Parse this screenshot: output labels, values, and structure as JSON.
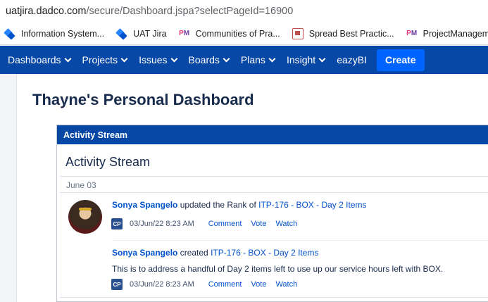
{
  "browser": {
    "url_host": "uatjira.dadco.com",
    "url_path": "/secure/Dashboard.jspa?selectPageId=16900"
  },
  "bookmarks": [
    {
      "icon": "jira-icon",
      "label": "Information System..."
    },
    {
      "icon": "jira-icon",
      "label": "UAT Jira"
    },
    {
      "icon": "pm-icon",
      "label": "Communities of Pra..."
    },
    {
      "icon": "presentation-icon",
      "label": "Spread Best Practic..."
    },
    {
      "icon": "pm-icon",
      "label": "ProjectManagemen..."
    }
  ],
  "nav": {
    "items": [
      {
        "label": "Dashboards",
        "has_dropdown": true
      },
      {
        "label": "Projects",
        "has_dropdown": true
      },
      {
        "label": "Issues",
        "has_dropdown": true
      },
      {
        "label": "Boards",
        "has_dropdown": true
      },
      {
        "label": "Plans",
        "has_dropdown": true
      },
      {
        "label": "Insight",
        "has_dropdown": true
      },
      {
        "label": "eazyBI",
        "has_dropdown": false
      }
    ],
    "create_label": "Create",
    "colors": {
      "nav_bg": "#0747a6",
      "create_bg": "#0065ff"
    }
  },
  "page": {
    "title": "Thayne's Personal Dashboard"
  },
  "gadget": {
    "header": "Activity Stream",
    "title": "Activity Stream",
    "date_group": "June 03",
    "entries": [
      {
        "user": "Sonya Spangelo",
        "action": " updated the Rank of ",
        "issue": "ITP-176 - BOX - Day 2 Items",
        "badge": "CP",
        "timestamp": "03/Jun/22 8:23 AM",
        "actions": [
          "Comment",
          "Vote",
          "Watch"
        ]
      },
      {
        "user": "Sonya Spangelo",
        "action": " created ",
        "issue": "ITP-176 - BOX - Day 2 Items",
        "description": "This is to address a handful of Day 2 items left to use up our service hours left with BOX.",
        "badge": "CP",
        "timestamp": "03/Jun/22 8:23 AM",
        "actions": [
          "Comment",
          "Vote",
          "Watch"
        ]
      }
    ]
  }
}
